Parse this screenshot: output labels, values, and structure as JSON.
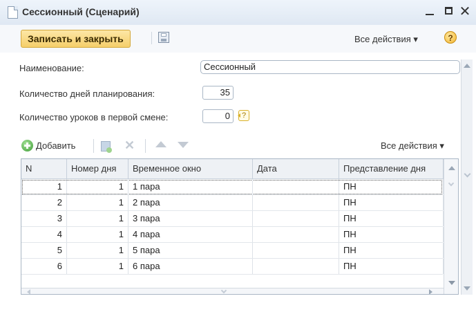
{
  "window": {
    "title": "Сессионный (Сценарий)",
    "controls": {
      "minimize": "_",
      "close": "✕"
    }
  },
  "command_bar": {
    "save_close_label": "Записать и закрыть",
    "all_actions_label": "Все действия ▾",
    "help_label": "?"
  },
  "form": {
    "name_label": "Наименование:",
    "name_value": "Сессионный",
    "days_label": "Количество дней планирования:",
    "days_value": "35",
    "lessons_label": "Количество уроков в первой смене:",
    "lessons_value": "0",
    "lessons_hint": "?"
  },
  "table_toolbar": {
    "add_label": "Добавить",
    "all_actions_label": "Все действия ▾"
  },
  "table": {
    "columns": [
      "N",
      "Номер дня",
      "Временное окно",
      "Дата",
      "Представление дня"
    ],
    "rows": [
      {
        "n": "1",
        "day": "1",
        "window": "1 пара",
        "date": "",
        "view": "ПН"
      },
      {
        "n": "2",
        "day": "1",
        "window": "2 пара",
        "date": "",
        "view": "ПН"
      },
      {
        "n": "3",
        "day": "1",
        "window": "3 пара",
        "date": "",
        "view": "ПН"
      },
      {
        "n": "4",
        "day": "1",
        "window": "4 пара",
        "date": "",
        "view": "ПН"
      },
      {
        "n": "5",
        "day": "1",
        "window": "5 пара",
        "date": "",
        "view": "ПН"
      },
      {
        "n": "6",
        "day": "1",
        "window": "6 пара",
        "date": "",
        "view": "ПН"
      }
    ]
  },
  "colors": {
    "accent_button": "#f5cf6a",
    "titlebar": "#dfe8f3",
    "border": "#a9b6c5"
  }
}
